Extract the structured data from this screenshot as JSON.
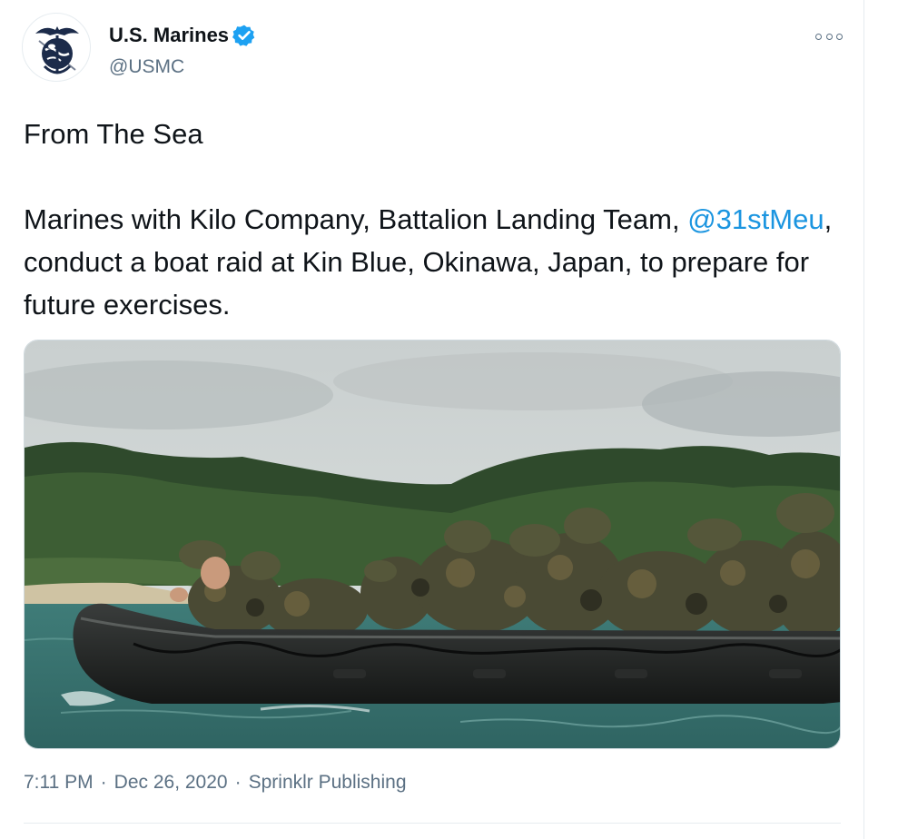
{
  "author": {
    "name": "U.S. Marines",
    "handle": "@USMC",
    "verified": true
  },
  "tweet": {
    "title_line": "From The Sea",
    "body_before_mention": "Marines with Kilo Company, Battalion Landing Team, ",
    "mention": "@31stMeu",
    "body_after_mention": ", conduct a boat raid at Kin Blue, Okinawa, Japan, to prepare for future exercises."
  },
  "meta": {
    "time": "7:11 PM",
    "date": "Dec 26, 2020",
    "separator": "·",
    "source": "Sprinklr Publishing"
  },
  "icons": {
    "more": "more-options-icon",
    "verified": "verified-badge-icon",
    "avatar": "marine-corps-emblem-icon"
  },
  "colors": {
    "text": "#0f1419",
    "secondary": "#5b7083",
    "link": "#1b95e0",
    "verified": "#1da1f2",
    "border": "#e6ecf0"
  }
}
